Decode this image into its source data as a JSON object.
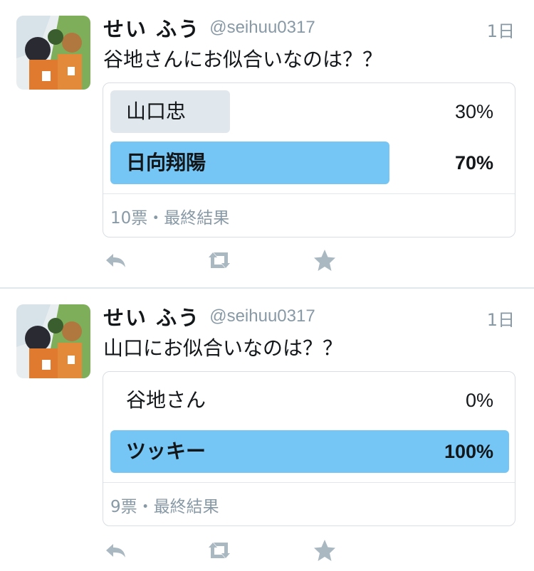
{
  "tweets": [
    {
      "author": {
        "display_name": "せい ふう",
        "handle": "@seihuu0317"
      },
      "timestamp": "1日",
      "text": "谷地さんにお似合いなのは？？",
      "poll": {
        "options": [
          {
            "label": "山口忠",
            "percent": "30%",
            "value": 0.3,
            "winner": false
          },
          {
            "label": "日向翔陽",
            "percent": "70%",
            "value": 0.7,
            "winner": true
          }
        ],
        "footer": "10票・最終結果"
      },
      "actions": [
        "reply-icon",
        "retweet-icon",
        "like-star-icon"
      ]
    },
    {
      "author": {
        "display_name": "せい ふう",
        "handle": "@seihuu0317"
      },
      "timestamp": "1日",
      "text": "山口にお似合いなのは？？",
      "poll": {
        "options": [
          {
            "label": "谷地さん",
            "percent": "0%",
            "value": 0.0,
            "winner": false
          },
          {
            "label": "ツッキー",
            "percent": "100%",
            "value": 1.0,
            "winner": true
          }
        ],
        "footer": "9票・最終結果"
      },
      "actions": [
        "reply-icon",
        "retweet-icon",
        "like-star-icon"
      ]
    }
  ],
  "colors": {
    "winner_bar": "#75c6f4",
    "loser_bar": "#e1e8ed",
    "meta_text": "#8899a6",
    "action_icon": "#aab8c2"
  }
}
